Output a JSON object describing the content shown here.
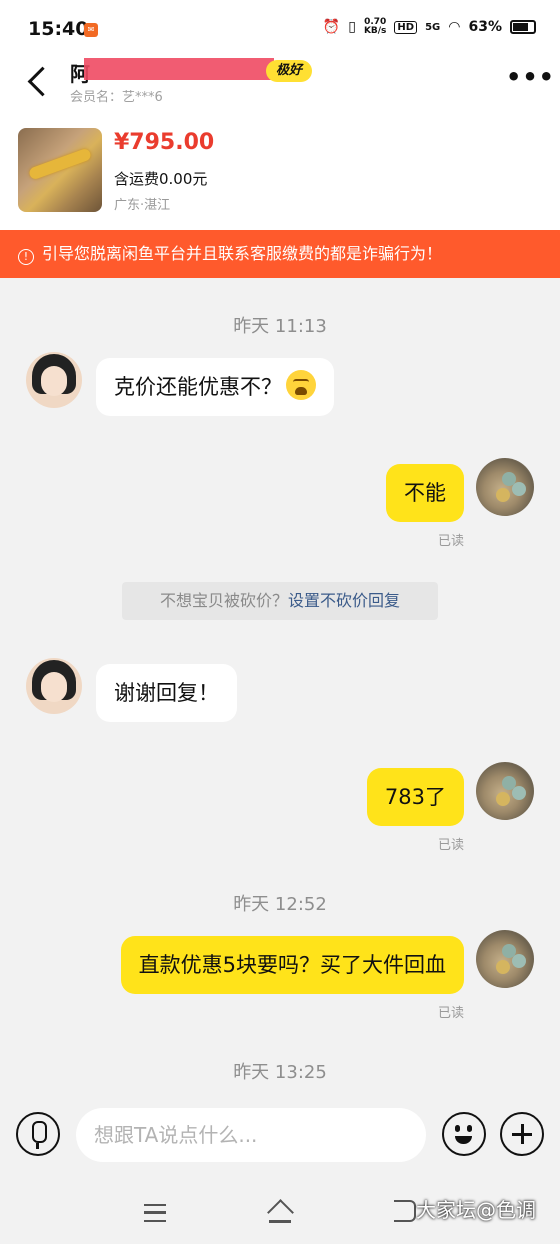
{
  "status_bar": {
    "time": "15:40",
    "net_speed_top": "0.70",
    "net_speed_bottom": "KB/s",
    "hd": "HD",
    "signal": "5G",
    "battery": "63%"
  },
  "header": {
    "name_visible": "阿",
    "credit_badge": "极好",
    "member_label": "会员名：艺***6"
  },
  "product": {
    "price": "¥795.00",
    "shipping": "含运费0.00元",
    "location": "广东·湛江"
  },
  "warning": {
    "icon": "!",
    "text": "引导您脱离闲鱼平台并且联系客服缴费的都是诈骗行为！"
  },
  "messages": {
    "t1": "昨天 11:13",
    "m1": "克价还能优惠不？",
    "m2": "不能",
    "m2_read": "已读",
    "sys_prefix": "不想宝贝被砍价？",
    "sys_link": "设置不砍价回复",
    "m3": "谢谢回复！",
    "m4": "783了",
    "m4_read": "已读",
    "t2": "昨天 12:52",
    "m5": "直款优惠5块要吗？买了大件回血",
    "m5_read": "已读",
    "t3": "昨天 13:25"
  },
  "input": {
    "placeholder": "想跟TA说点什么..."
  },
  "watermark": "大家坛@色调",
  "icons": [
    "back-icon",
    "more-icon",
    "mic-icon",
    "emoji-icon",
    "plus-icon",
    "menu-icon",
    "home-icon",
    "back-nav-icon"
  ]
}
